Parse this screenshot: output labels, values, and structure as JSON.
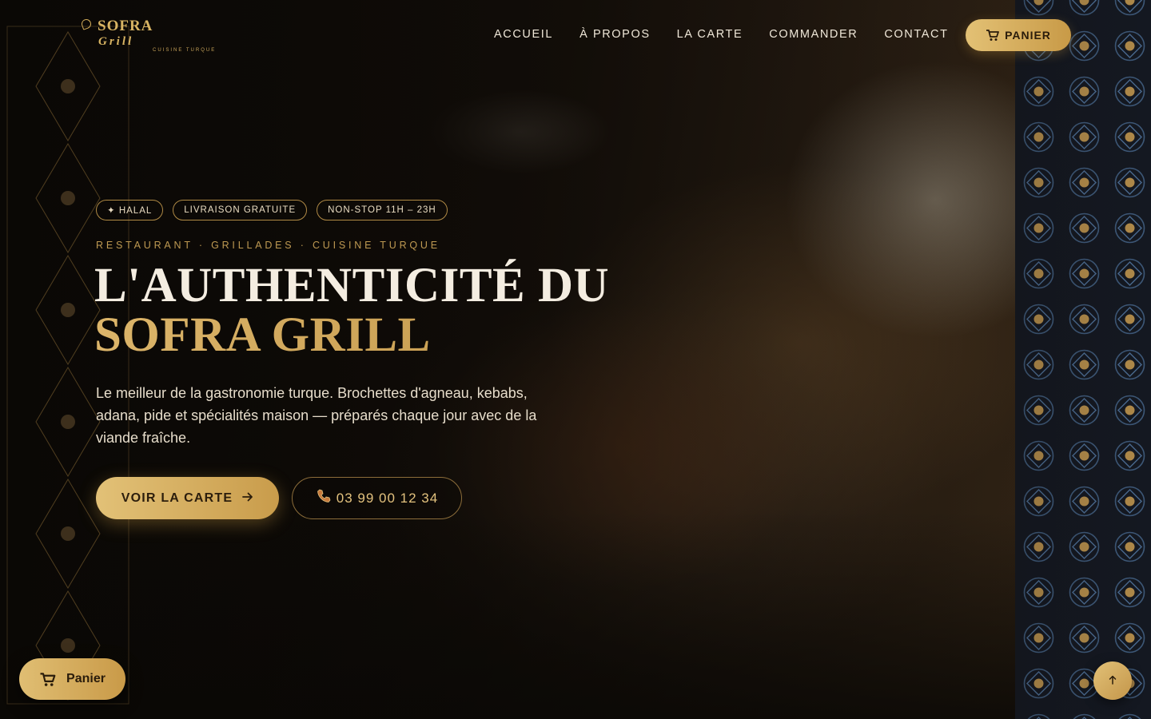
{
  "brand": {
    "name": "SOFRA",
    "sub": "Grill",
    "tagline": "CUISINE TURQUE"
  },
  "nav": {
    "items": [
      {
        "label": "ACCUEIL"
      },
      {
        "label": "À PROPOS"
      },
      {
        "label": "LA CARTE"
      },
      {
        "label": "COMMANDER"
      },
      {
        "label": "CONTACT"
      }
    ],
    "cart_label": "PANIER",
    "cart_icon": "cart-icon"
  },
  "hero": {
    "badges": [
      {
        "label": "✦ HALAL"
      },
      {
        "label": "LIVRAISON GRATUITE"
      },
      {
        "label": "NON-STOP 11H – 23H"
      }
    ],
    "eyebrow": "RESTAURANT · GRILLADES · CUISINE TURQUE",
    "title_line1": "L'AUTHENTICITÉ DU",
    "title_line2": "SOFRA GRILL",
    "description": "Le meilleur de la gastronomie turque. Brochettes d'agneau, kebabs, adana, pide et spécialités maison — préparés chaque jour avec de la viande fraîche.",
    "cta_primary": "VOIR LA CARTE",
    "cta_primary_icon": "arrow-right-icon",
    "cta_phone": "03 99 00 12 34",
    "cta_phone_icon": "phone-icon"
  },
  "floating": {
    "cart_label": "Panier",
    "cart_icon": "cart-icon",
    "to_top_icon": "arrow-up-icon"
  },
  "colors": {
    "gold": "#d4ad5a",
    "gold_light": "#e2c177",
    "background": "#0d0a07",
    "text": "#f3ece0"
  }
}
